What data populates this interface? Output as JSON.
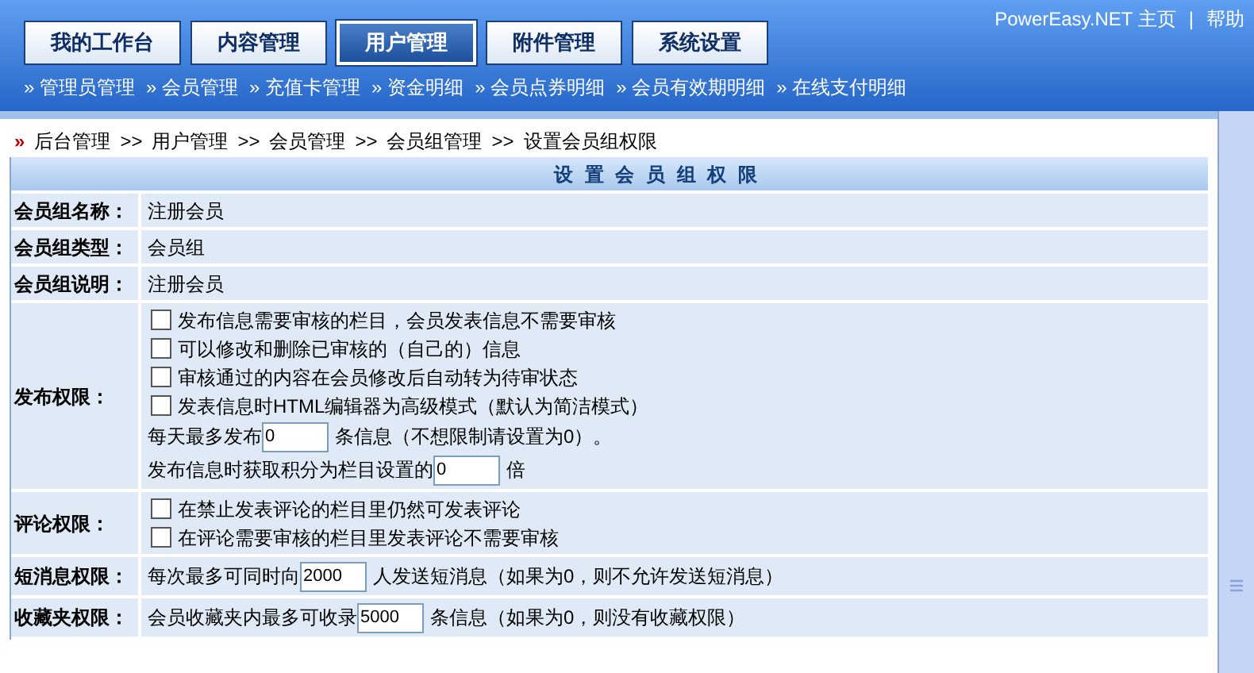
{
  "header_links": [
    {
      "label": "PowerEasy.NET 主页"
    },
    {
      "label": "帮助"
    }
  ],
  "header_separator": "|",
  "tabs": [
    {
      "label": "我的工作台",
      "selected": false
    },
    {
      "label": "内容管理",
      "selected": false
    },
    {
      "label": "用户管理",
      "selected": true
    },
    {
      "label": "附件管理",
      "selected": false
    },
    {
      "label": "系统设置",
      "selected": false
    }
  ],
  "submenu": [
    "» 管理员管理",
    "» 会员管理",
    "» 充值卡管理",
    "» 资金明细",
    "» 会员点券明细",
    "» 会员有效期明细",
    "» 在线支付明细"
  ],
  "breadcrumb": {
    "marker": "»",
    "items": [
      {
        "label": "后台管理",
        "separator": ">>"
      },
      {
        "label": "用户管理",
        "separator": ">>"
      },
      {
        "label": "会员管理",
        "separator": ">>"
      },
      {
        "label": "会员组管理",
        "separator": ">>"
      },
      {
        "label": "设置会员组权限"
      }
    ]
  },
  "form": {
    "title": "设 置 会 员 组 权 限",
    "rows": [
      {
        "label": "会员组名称：",
        "lines": [
          {
            "kind": "text",
            "text": "注册会员"
          }
        ]
      },
      {
        "label": "会员组类型：",
        "lines": [
          {
            "kind": "text",
            "text": "会员组"
          }
        ]
      },
      {
        "label": "会员组说明：",
        "lines": [
          {
            "kind": "text",
            "text": "注册会员"
          }
        ]
      },
      {
        "label": "发布权限：",
        "lines": [
          {
            "kind": "checkbox",
            "label": "发布信息需要审核的栏目，会员发表信息不需要审核",
            "checked": false
          },
          {
            "kind": "checkbox",
            "label": "可以修改和删除已审核的（自己的）信息",
            "checked": false
          },
          {
            "kind": "checkbox",
            "label": "审核通过的内容在会员修改后自动转为待审状态",
            "checked": false
          },
          {
            "kind": "checkbox",
            "label": "发表信息时HTML编辑器为高级模式（默认为简洁模式）",
            "checked": false
          },
          {
            "kind": "input",
            "before": "每天最多发布",
            "value": "0",
            "after": "条信息（不想限制请设置为0）。"
          },
          {
            "kind": "input",
            "before": "发布信息时获取积分为栏目设置的",
            "value": "0",
            "after": "倍"
          }
        ]
      },
      {
        "label": "评论权限：",
        "lines": [
          {
            "kind": "checkbox",
            "label": "在禁止发表评论的栏目里仍然可发表评论",
            "checked": false
          },
          {
            "kind": "checkbox",
            "label": "在评论需要审核的栏目里发表评论不需要审核",
            "checked": false
          }
        ]
      },
      {
        "label": "短消息权限：",
        "lines": [
          {
            "kind": "input",
            "before": "每次最多可同时向",
            "value": "2000",
            "after": "人发送短消息（如果为0，则不允许发送短消息）"
          }
        ]
      },
      {
        "label": "收藏夹权限：",
        "lines": [
          {
            "kind": "input",
            "before": "会员收藏夹内最多可收录",
            "value": "5000",
            "after": "条信息（如果为0，则没有收藏权限）"
          }
        ]
      }
    ]
  }
}
